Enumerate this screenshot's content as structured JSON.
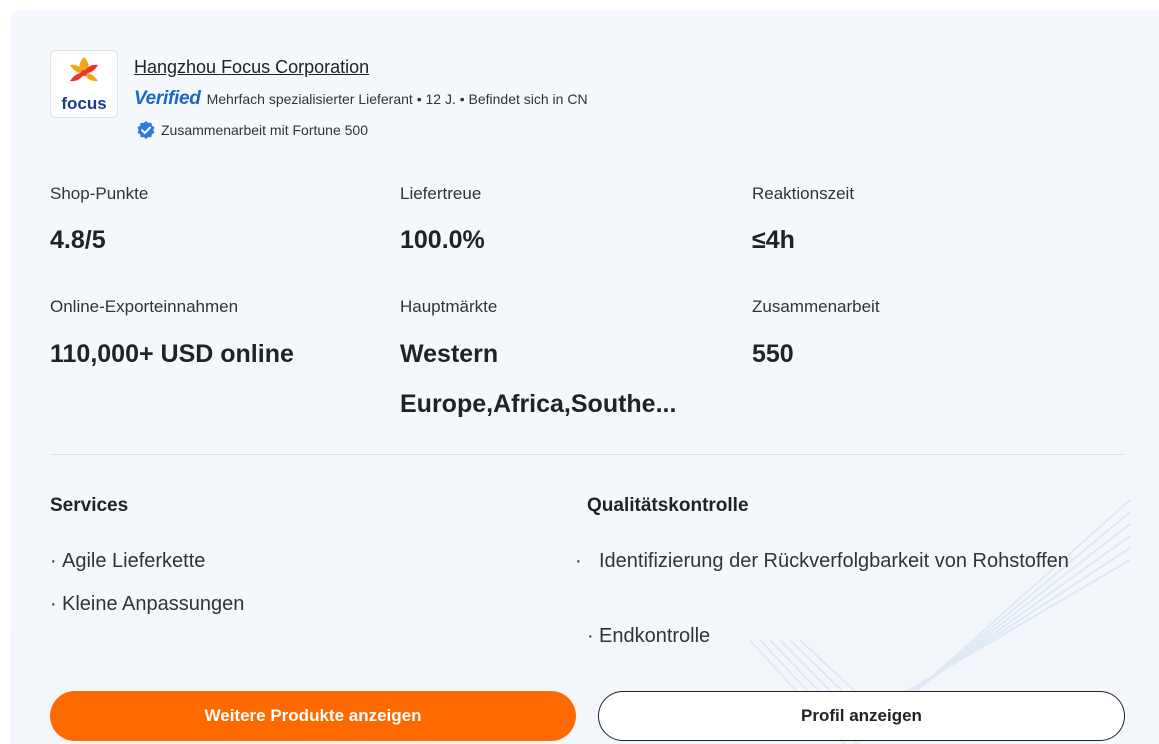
{
  "supplier": {
    "name": "Hangzhou Focus Corporation",
    "logo_text": "focus",
    "verified_label": "Verified",
    "meta": "Mehrfach spezialisierter Lieferant • 12 J. • Befindet sich in CN",
    "fortune": "Zusammenarbeit mit Fortune 500"
  },
  "stats": [
    {
      "label": "Shop-Punkte",
      "value": "4.8/5"
    },
    {
      "label": "Liefertreue",
      "value": "100.0%"
    },
    {
      "label": "Reaktionszeit",
      "value": "≤4h"
    },
    {
      "label": "Online-Exporteinnahmen",
      "value": "110,000+ USD online"
    },
    {
      "label": "Hauptmärkte",
      "value": "Western Europe,Africa,Southe..."
    },
    {
      "label": "Zusammenarbeit",
      "value": "550"
    }
  ],
  "services": {
    "title": "Services",
    "items": [
      "Agile Lieferkette",
      "Kleine Anpassungen"
    ]
  },
  "quality": {
    "title": "Qualitätskontrolle",
    "items": [
      "Identifizierung der Rückverfolgbarkeit von Rohstoffen",
      "Endkontrolle"
    ]
  },
  "buttons": {
    "more_products": "Weitere Produkte anzeigen",
    "view_profile": "Profil anzeigen"
  },
  "colors": {
    "accent": "#ff6a00",
    "verified": "#1a66c9",
    "badge": "#2b7be0"
  }
}
